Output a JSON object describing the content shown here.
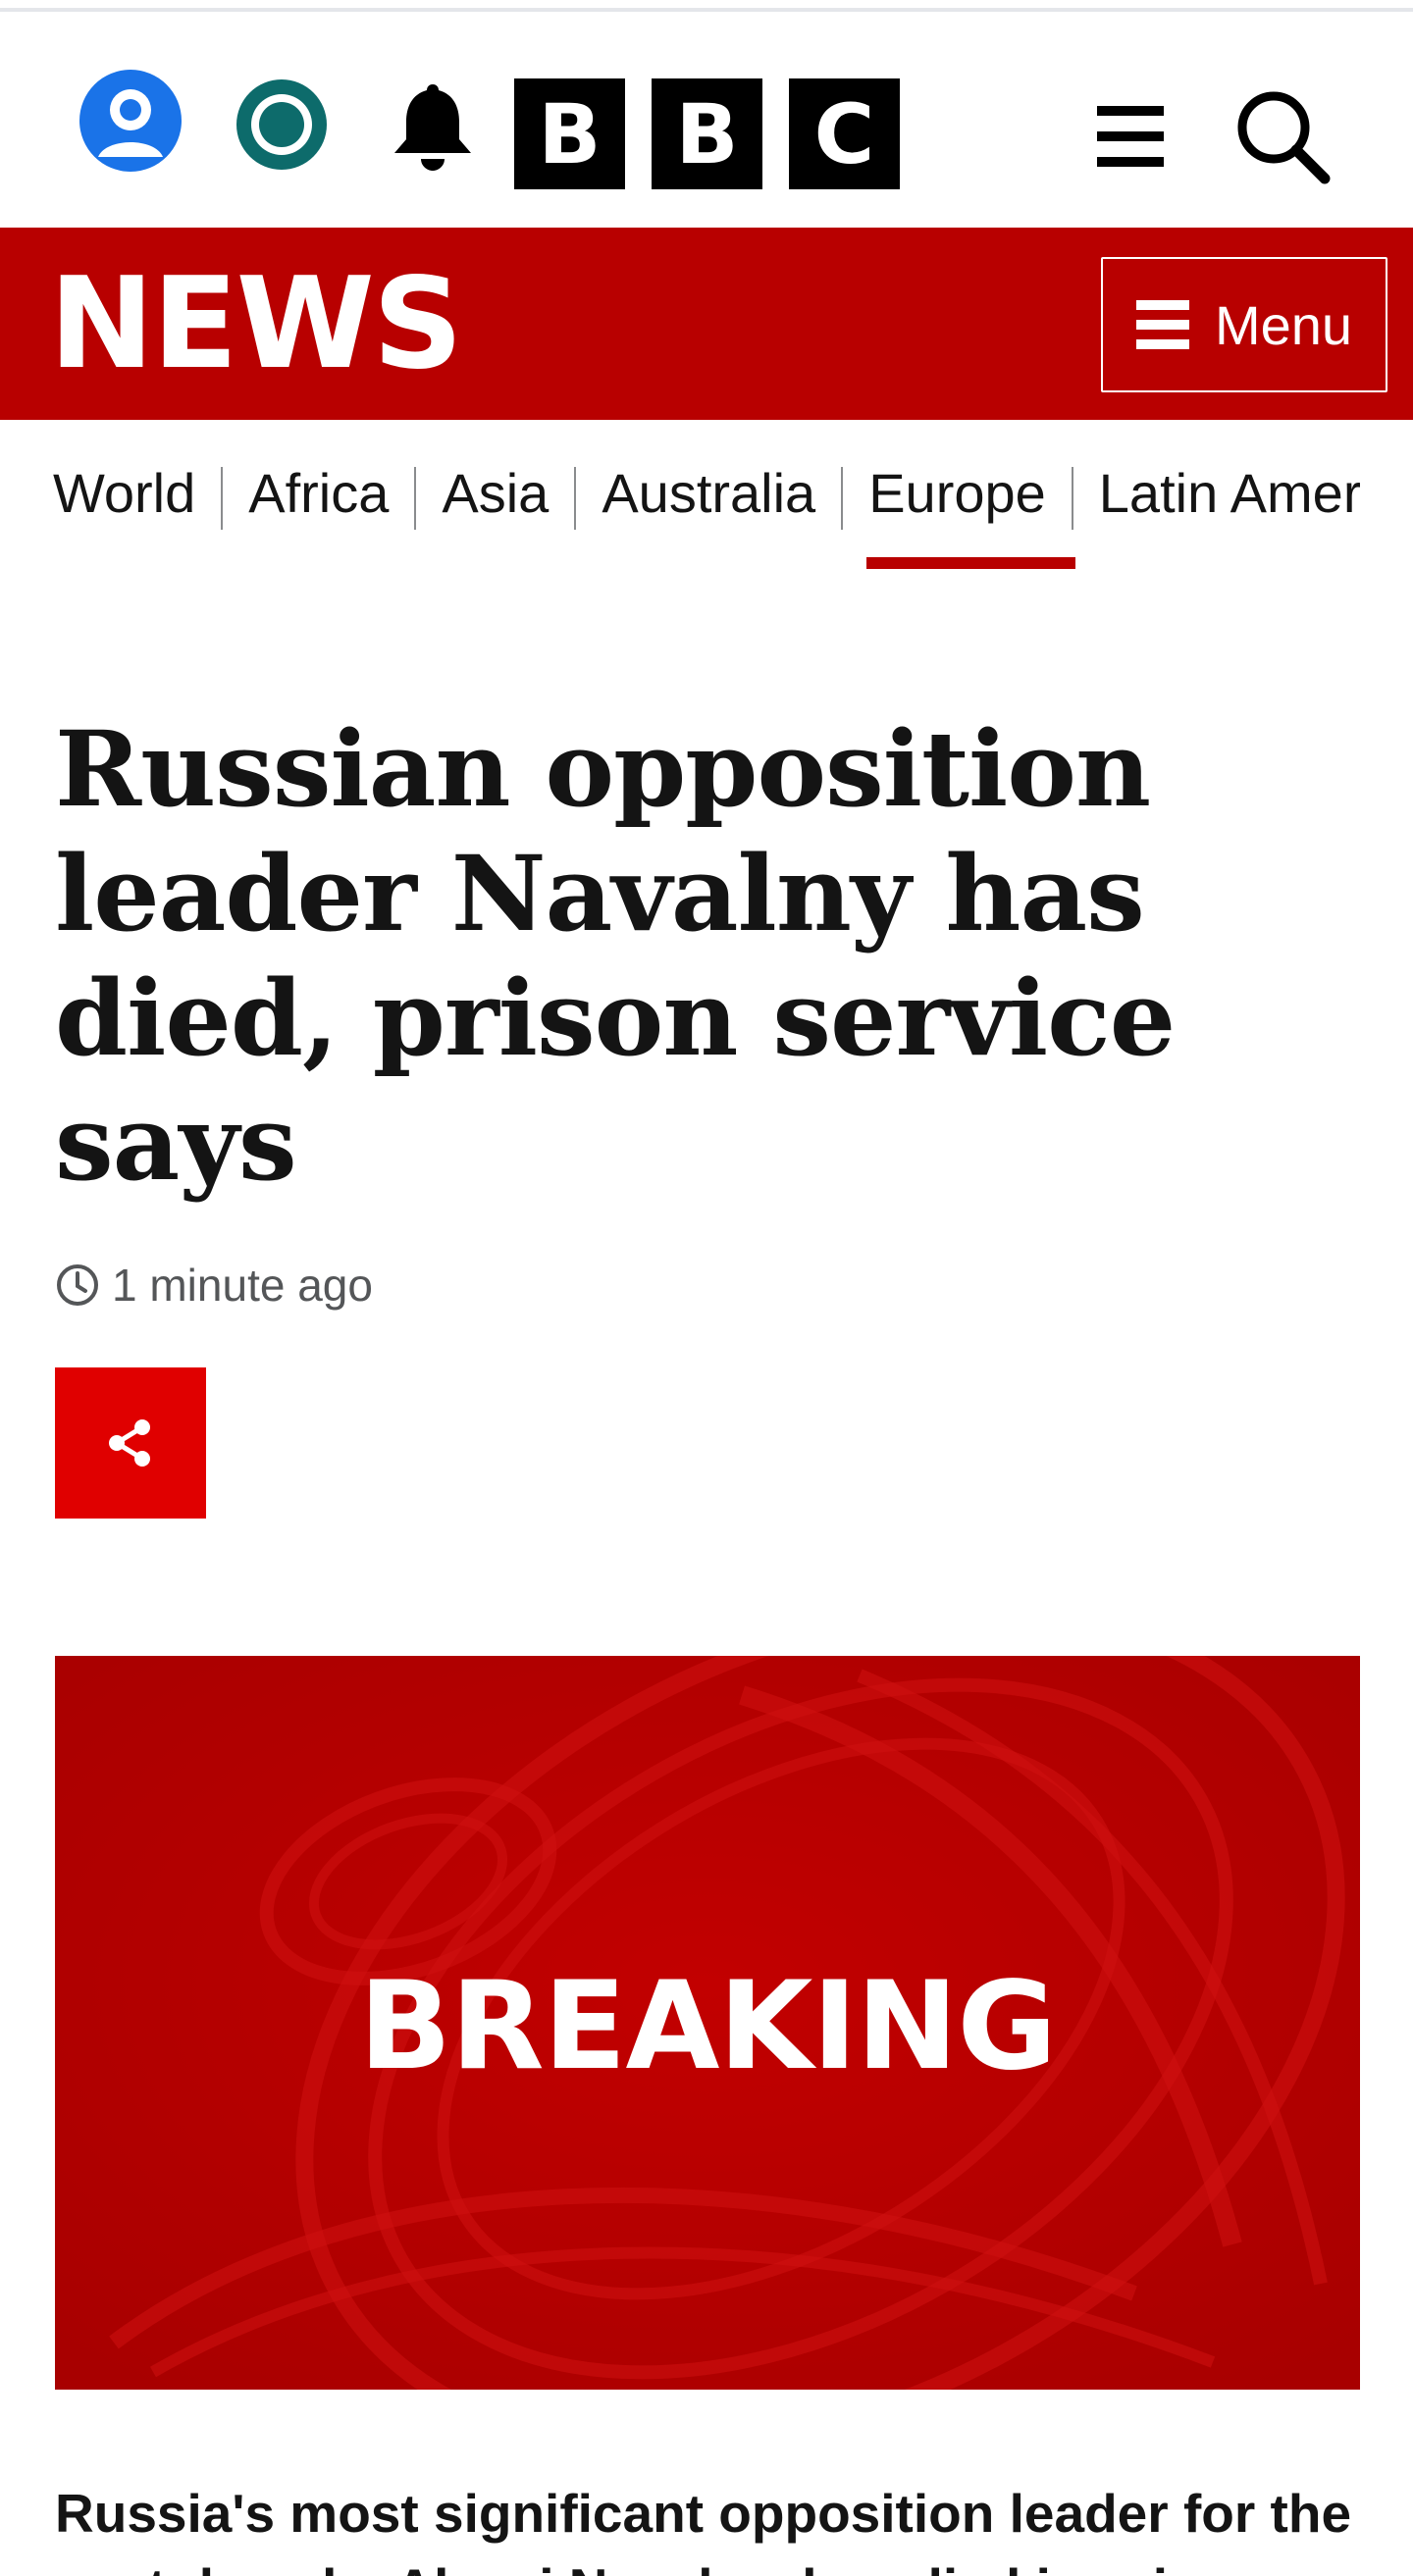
{
  "header": {
    "logo_letters": [
      "B",
      "B",
      "C"
    ],
    "icons": [
      "account-icon",
      "sounds-icon",
      "notifications-bell-icon",
      "hamburger-icon",
      "search-icon"
    ]
  },
  "masthead": {
    "title": "NEWS",
    "menu_label": "Menu",
    "brand_color": "#b80000"
  },
  "section_nav": {
    "items": [
      "World",
      "Africa",
      "Asia",
      "Australia",
      "Europe",
      "Latin America"
    ],
    "active": "Europe"
  },
  "article": {
    "headline": "Russian opposition leader Navalny has died, prison service says",
    "timestamp": "1 minute ago",
    "share_icon": "share-icon",
    "share_color": "#e00000",
    "hero_text": "BREAKING",
    "lede": "Russia's most significant opposition leader for the past decade, Alexei Navalny, has died in prison"
  }
}
